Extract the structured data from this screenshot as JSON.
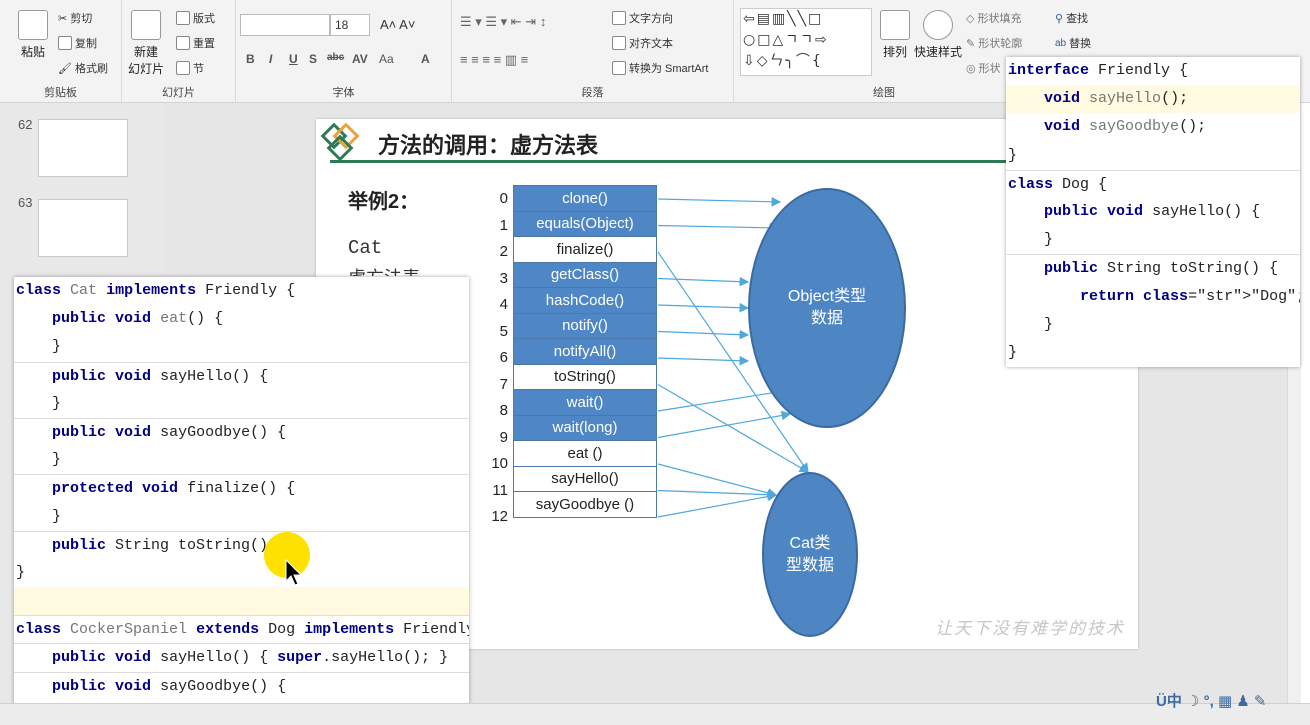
{
  "ribbon": {
    "clipboard": {
      "paste": "粘贴",
      "cut": "剪切",
      "copy": "复制",
      "format_painter": "格式刷",
      "group": "剪贴板"
    },
    "slides": {
      "new_slide": "新建\n幻灯片",
      "layout": "版式",
      "reset": "重置",
      "section": "节",
      "group": "幻灯片"
    },
    "font": {
      "size": "18",
      "group": "字体",
      "bold": "B",
      "italic": "I",
      "underline": "U",
      "strike": "S",
      "abc": "abc",
      "spacing": "AV",
      "case": "Aa",
      "color": "A"
    },
    "paragraph": {
      "text_direction": "文字方向",
      "align_text": "对齐文本",
      "convert_smartart": "转换为 SmartArt",
      "group": "段落"
    },
    "drawing": {
      "arrange": "排列",
      "quick_styles": "快速样式",
      "shape_fill": "形状填充",
      "shape_outline": "形状轮廓",
      "shape_effects": "形状",
      "group": "绘图"
    },
    "editing": {
      "find": "查找",
      "replace": "替换"
    }
  },
  "sidebar": {
    "slides": [
      {
        "num": "62"
      },
      {
        "num": "63"
      }
    ]
  },
  "slide": {
    "title": "方法的调用：虚方法表",
    "example": "举例2：",
    "cat_label": "Cat",
    "vtable_label": "虚方法表",
    "vtable": [
      {
        "i": "0",
        "name": "clone()",
        "type": "blue"
      },
      {
        "i": "1",
        "name": "equals(Object)",
        "type": "blue"
      },
      {
        "i": "2",
        "name": "finalize()",
        "type": "white"
      },
      {
        "i": "3",
        "name": "getClass()",
        "type": "blue"
      },
      {
        "i": "4",
        "name": "hashCode()",
        "type": "blue"
      },
      {
        "i": "5",
        "name": "notify()",
        "type": "blue"
      },
      {
        "i": "6",
        "name": "notifyAll()",
        "type": "blue"
      },
      {
        "i": "7",
        "name": "toString()",
        "type": "white"
      },
      {
        "i": "8",
        "name": "wait()",
        "type": "blue"
      },
      {
        "i": "9",
        "name": "wait(long)",
        "type": "blue"
      },
      {
        "i": "10",
        "name": "eat ()",
        "type": "white"
      },
      {
        "i": "11",
        "name": "sayHello()",
        "type": "white"
      },
      {
        "i": "12",
        "name": "sayGoodbye ()",
        "type": "white"
      }
    ],
    "object_circle": "Object类型\n数据",
    "cat_circle": "Cat类\n型数据",
    "watermark": "让天下没有难学的技术"
  },
  "code_left": {
    "lines": [
      "class Cat implements Friendly {",
      "    public void eat() {",
      "    }",
      "    public void sayHello() {",
      "    }",
      "    public void sayGoodbye() {",
      "    }",
      "    protected void finalize() {",
      "    }",
      "    public String toString(){}",
      "}",
      "",
      "class CockerSpaniel extends Dog implements Friendly {",
      "    public void sayHello() { super.sayHello(); }",
      "    public void sayGoodbye() {",
      "    }"
    ]
  },
  "code_right": {
    "lines": [
      "interface Friendly {",
      "    void sayHello();",
      "    void sayGoodbye();",
      "}",
      "class Dog {",
      "    public void sayHello() {",
      "    }",
      "    public String toString() {",
      "        return \"Dog\";",
      "    }",
      "}"
    ]
  },
  "taskbar": {
    "ime": "中"
  },
  "colors": {
    "accent": "#4f86c6",
    "green_rule": "#2d7a56",
    "pointer": "#ffe100"
  }
}
